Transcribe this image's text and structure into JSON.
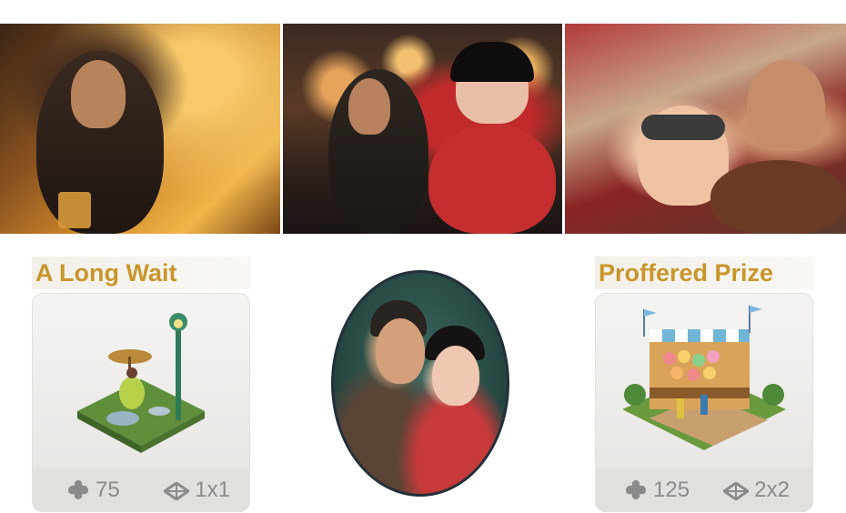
{
  "story_panels": [
    {
      "scene": "man-drinking-at-bar"
    },
    {
      "scene": "couple-on-night-street"
    },
    {
      "scene": "aviators-in-plane"
    }
  ],
  "rewards": {
    "left": {
      "title": "A Long Wait",
      "building": "lamp-post-garden-decoration",
      "happiness": "75",
      "size": "1x1"
    },
    "right": {
      "title": "Proffered Prize",
      "building": "carnival-prize-stand",
      "happiness": "125",
      "size": "2x2"
    }
  },
  "portrait": {
    "subject": "couple-portrait"
  },
  "colors": {
    "title": "#c8962c",
    "stat_text": "#8c8a88",
    "card_bg": "#f5f4f2"
  },
  "icons": [
    "happiness-icon",
    "size-icon"
  ]
}
